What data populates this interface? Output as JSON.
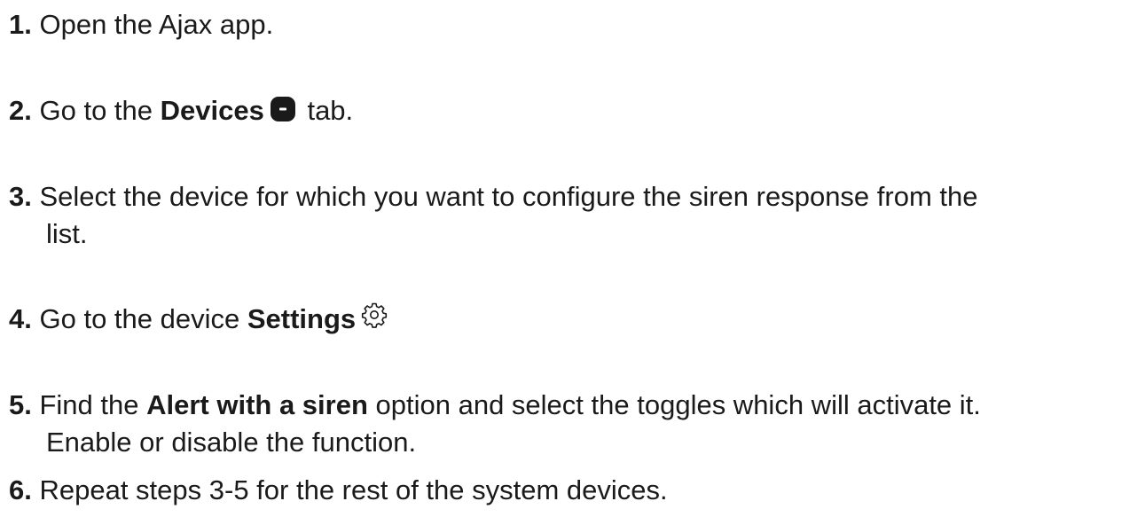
{
  "steps": [
    {
      "num": "1.",
      "text": "Open the Ajax app."
    },
    {
      "num": "2.",
      "before": "Go to the ",
      "bold": "Devices",
      "after": " tab.",
      "icon": "devices-icon"
    },
    {
      "num": "3.",
      "line1": "Select the device for which you want to configure the siren response from the",
      "line2": "list."
    },
    {
      "num": "4.",
      "before": "Go to the device ",
      "bold": "Settings",
      "icon": "gear-icon"
    },
    {
      "num": "5.",
      "before": "Find the ",
      "bold": "Alert with a siren",
      "after": " option and select the toggles which will activate it.",
      "line2": "Enable or disable the function."
    },
    {
      "num": "6.",
      "text": "Repeat steps 3-5 for the rest of the system devices."
    }
  ]
}
